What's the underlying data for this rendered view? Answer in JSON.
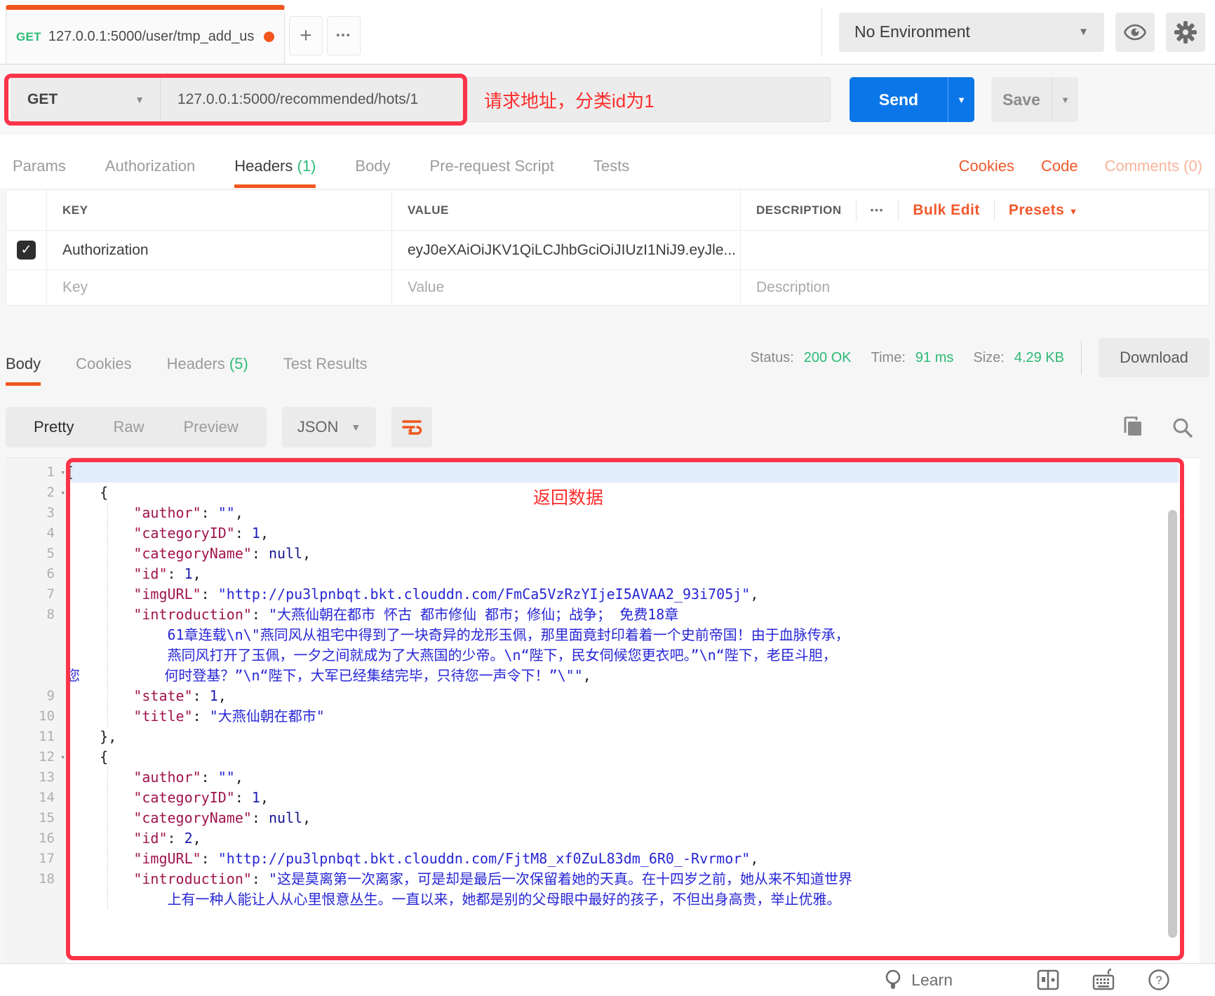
{
  "header": {
    "tab": {
      "method": "GET",
      "url": "127.0.0.1:5000/user/tmp_add_us"
    },
    "new_tab_label": "+",
    "more_tabs_label": "•••",
    "environment": "No Environment"
  },
  "request": {
    "method": "GET",
    "url": "127.0.0.1:5000/recommended/hots/1",
    "annotation": "请求地址，分类id为1",
    "send_label": "Send",
    "save_label": "Save"
  },
  "request_tabs": {
    "params": "Params",
    "authorization": "Authorization",
    "headers": "Headers",
    "headers_count": "(1)",
    "body": "Body",
    "prerequest": "Pre-request Script",
    "tests": "Tests",
    "cookies_link": "Cookies",
    "code_link": "Code",
    "comments_link": "Comments (0)"
  },
  "headers_table": {
    "col_key": "KEY",
    "col_value": "VALUE",
    "col_description": "DESCRIPTION",
    "more": "•••",
    "bulk_edit": "Bulk Edit",
    "presets": "Presets",
    "row": {
      "key": "Authorization",
      "value": "eyJ0eXAiOiJKV1QiLCJhbGciOiJIUzI1NiJ9.eyJle..."
    },
    "placeholder": {
      "key": "Key",
      "value": "Value",
      "description": "Description"
    }
  },
  "response": {
    "tab_body": "Body",
    "tab_cookies": "Cookies",
    "tab_headers": "Headers",
    "tab_headers_count": "(5)",
    "tab_tests": "Test Results",
    "status_label": "Status:",
    "status_value": "200 OK",
    "time_label": "Time:",
    "time_value": "91 ms",
    "size_label": "Size:",
    "size_value": "4.29 KB",
    "download_label": "Download",
    "mode_pretty": "Pretty",
    "mode_raw": "Raw",
    "mode_preview": "Preview",
    "language": "JSON",
    "annotation": "返回数据"
  },
  "code": {
    "rows": [
      {
        "g": "1",
        "fold": true,
        "hl": true,
        "segs": [
          [
            "p",
            "["
          ]
        ]
      },
      {
        "g": "2",
        "fold": true,
        "segs": [
          [
            "p",
            "    {"
          ]
        ]
      },
      {
        "g": "3",
        "gd": true,
        "segs": [
          [
            "p",
            "        "
          ],
          [
            "k",
            "\"author\""
          ],
          [
            "p",
            ": "
          ],
          [
            "s",
            "\"\""
          ],
          [
            "p",
            ","
          ]
        ]
      },
      {
        "g": "4",
        "gd": true,
        "segs": [
          [
            "p",
            "        "
          ],
          [
            "k",
            "\"categoryID\""
          ],
          [
            "p",
            ": "
          ],
          [
            "n",
            "1"
          ],
          [
            "p",
            ","
          ]
        ]
      },
      {
        "g": "5",
        "gd": true,
        "segs": [
          [
            "p",
            "        "
          ],
          [
            "k",
            "\"categoryName\""
          ],
          [
            "p",
            ": "
          ],
          [
            "u",
            "null"
          ],
          [
            "p",
            ","
          ]
        ]
      },
      {
        "g": "6",
        "gd": true,
        "segs": [
          [
            "p",
            "        "
          ],
          [
            "k",
            "\"id\""
          ],
          [
            "p",
            ": "
          ],
          [
            "n",
            "1"
          ],
          [
            "p",
            ","
          ]
        ]
      },
      {
        "g": "7",
        "gd": true,
        "segs": [
          [
            "p",
            "        "
          ],
          [
            "k",
            "\"imgURL\""
          ],
          [
            "p",
            ": "
          ],
          [
            "s",
            "\"http://pu3lpnbqt.bkt.clouddn.com/FmCa5VzRzYIjeI5AVAA2_93i705j\""
          ],
          [
            "p",
            ","
          ]
        ]
      },
      {
        "g": "8",
        "gd": true,
        "segs": [
          [
            "p",
            "        "
          ],
          [
            "k",
            "\"introduction\""
          ],
          [
            "p",
            ": "
          ],
          [
            "s",
            "\"大燕仙朝在都市 怀古 都市修仙 都市；修仙；战争； 免费18章"
          ]
        ]
      },
      {
        "g": "",
        "gd": true,
        "segs": [
          [
            "p",
            "            "
          ],
          [
            "s",
            "61章连载\\n\\\"燕同风从祖宅中得到了一块奇异的龙形玉佩，那里面竟封印着着一个史前帝国！由于血脉传承，"
          ]
        ]
      },
      {
        "g": "",
        "gd": true,
        "segs": [
          [
            "p",
            "            "
          ],
          [
            "s",
            "燕同风打开了玉佩，一夕之间就成为了大燕国的少帝。\\n“陛下，民女伺候您更衣吧。”\\n“陛下，老臣斗胆，"
          ]
        ]
      },
      {
        "g": "",
        "gd": true,
        "segs": [
          [
            "s",
            "您"
          ],
          [
            "p",
            "          "
          ],
          [
            "s",
            "何时登基？”\\n“陛下，大军已经集结完毕，只待您一声令下！”\\\"\""
          ],
          [
            "p",
            ","
          ]
        ]
      },
      {
        "g": "9",
        "gd": true,
        "segs": [
          [
            "p",
            "        "
          ],
          [
            "k",
            "\"state\""
          ],
          [
            "p",
            ": "
          ],
          [
            "n",
            "1"
          ],
          [
            "p",
            ","
          ]
        ]
      },
      {
        "g": "10",
        "gd": true,
        "segs": [
          [
            "p",
            "        "
          ],
          [
            "k",
            "\"title\""
          ],
          [
            "p",
            ": "
          ],
          [
            "s",
            "\"大燕仙朝在都市\""
          ]
        ]
      },
      {
        "g": "11",
        "segs": [
          [
            "p",
            "    },"
          ]
        ]
      },
      {
        "g": "12",
        "fold": true,
        "segs": [
          [
            "p",
            "    {"
          ]
        ]
      },
      {
        "g": "13",
        "gd": true,
        "segs": [
          [
            "p",
            "        "
          ],
          [
            "k",
            "\"author\""
          ],
          [
            "p",
            ": "
          ],
          [
            "s",
            "\"\""
          ],
          [
            "p",
            ","
          ]
        ]
      },
      {
        "g": "14",
        "gd": true,
        "segs": [
          [
            "p",
            "        "
          ],
          [
            "k",
            "\"categoryID\""
          ],
          [
            "p",
            ": "
          ],
          [
            "n",
            "1"
          ],
          [
            "p",
            ","
          ]
        ]
      },
      {
        "g": "15",
        "gd": true,
        "segs": [
          [
            "p",
            "        "
          ],
          [
            "k",
            "\"categoryName\""
          ],
          [
            "p",
            ": "
          ],
          [
            "u",
            "null"
          ],
          [
            "p",
            ","
          ]
        ]
      },
      {
        "g": "16",
        "gd": true,
        "segs": [
          [
            "p",
            "        "
          ],
          [
            "k",
            "\"id\""
          ],
          [
            "p",
            ": "
          ],
          [
            "n",
            "2"
          ],
          [
            "p",
            ","
          ]
        ]
      },
      {
        "g": "17",
        "gd": true,
        "segs": [
          [
            "p",
            "        "
          ],
          [
            "k",
            "\"imgURL\""
          ],
          [
            "p",
            ": "
          ],
          [
            "s",
            "\"http://pu3lpnbqt.bkt.clouddn.com/FjtM8_xf0ZuL83dm_6R0_-Rvrmor\""
          ],
          [
            "p",
            ","
          ]
        ]
      },
      {
        "g": "18",
        "gd": true,
        "segs": [
          [
            "p",
            "        "
          ],
          [
            "k",
            "\"introduction\""
          ],
          [
            "p",
            ": "
          ],
          [
            "s",
            "\"这是莫离第一次离家，可是却是最后一次保留着她的天真。在十四岁之前，她从来不知道世界"
          ]
        ]
      },
      {
        "g": "",
        "gd": true,
        "segs": [
          [
            "p",
            "            "
          ],
          [
            "s",
            "上有一种人能让人从心里恨意丛生。一直以来，她都是别的父母眼中最好的孩子，不但出身高贵，举止优雅。"
          ]
        ]
      }
    ]
  },
  "footer": {
    "learn_label": "Learn"
  }
}
